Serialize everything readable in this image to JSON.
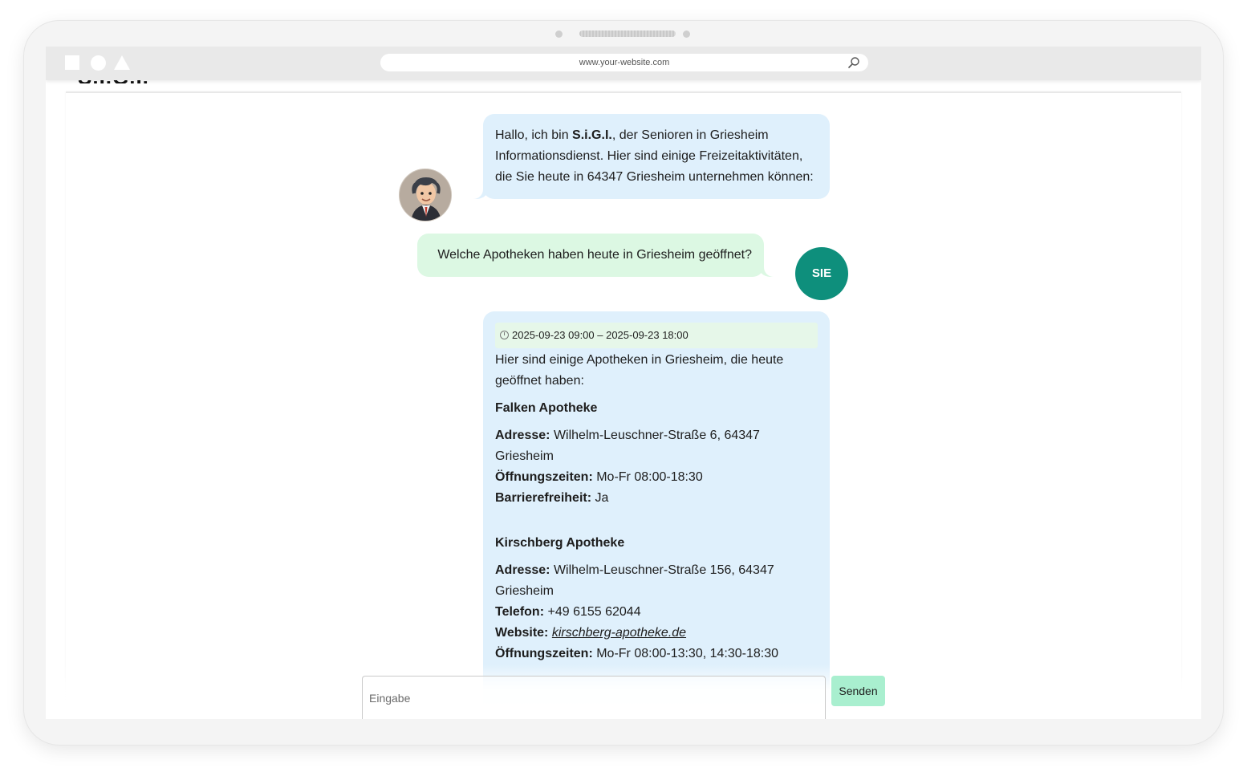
{
  "browser": {
    "url": "www.your-website.com",
    "icons": [
      "square-icon",
      "circle-icon",
      "triangle-icon",
      "search-icon"
    ]
  },
  "site": {
    "logo_text": "S.I.G.I."
  },
  "chat": {
    "bot_intro": {
      "before": "Hallo, ich bin ",
      "name": "S.i.G.I.",
      "after": ", der Senioren in Griesheim Informationsdienst. Hier sind einige Freizeitaktivitäten, die Sie heute in 64347 Griesheim unternehmen können:"
    },
    "user_question": "Welche Apotheken haben heute in Griesheim geöffnet?",
    "user_avatar_label": "SIE",
    "bot_answer": {
      "time_range": "2025-09-23 09:00 – 2025-09-23 18:00",
      "intro": "Hier sind einige Apotheken in Griesheim, die heute geöffnet haben:",
      "pharmacies": [
        {
          "name": "Falken Apotheke",
          "address_label": "Adresse:",
          "address": "Wilhelm-Leuschner-Straße 6, 64347 Griesheim",
          "hours_label": "Öffnungszeiten:",
          "hours": "Mo-Fr 08:00-18:30",
          "access_label": "Barrierefreiheit:",
          "access": "Ja"
        },
        {
          "name": "Kirschberg Apotheke",
          "address_label": "Adresse:",
          "address": "Wilhelm-Leuschner-Straße 156, 64347 Griesheim",
          "phone_label": "Telefon:",
          "phone": "+49 6155 62044",
          "website_label": "Website:",
          "website": "kirschberg-apotheke.de",
          "hours_label": "Öffnungszeiten:",
          "hours": "Mo-Fr 08:00-13:30, 14:30-18:30"
        }
      ]
    }
  },
  "composer": {
    "placeholder": "Eingabe",
    "send_label": "Senden"
  },
  "colors": {
    "bot_bubble": "#dff0fc",
    "user_bubble": "#dcf8e3",
    "user_avatar": "#0e8f7c",
    "send_button": "#a9efcf"
  }
}
